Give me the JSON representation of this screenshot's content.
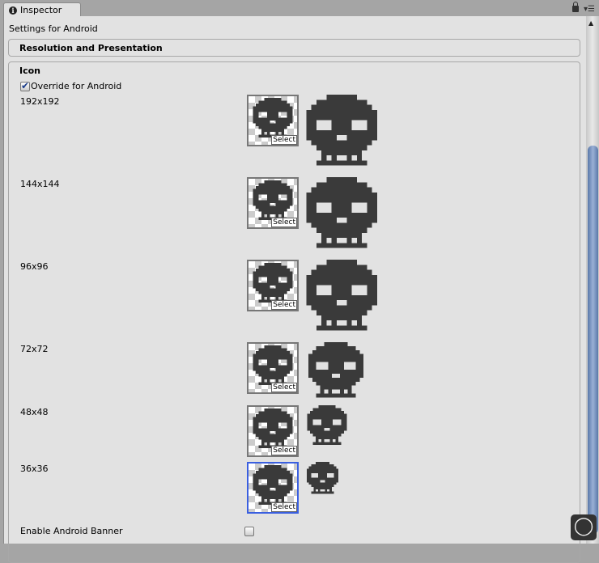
{
  "tab": {
    "title": "Inspector",
    "icon": "info-icon"
  },
  "header": {
    "settings": "Settings for Android",
    "section": "Resolution and Presentation"
  },
  "icon_section": {
    "title": "Icon",
    "override_label": "Override for Android",
    "override_checked": true,
    "rows": [
      {
        "size": "192x192"
      },
      {
        "size": "144x144"
      },
      {
        "size": "96x96"
      },
      {
        "size": "72x72"
      },
      {
        "size": "48x48"
      },
      {
        "size": "36x36",
        "selected": true
      }
    ],
    "select_label": "Select"
  },
  "banner": {
    "label": "Enable Android Banner",
    "checked": false
  },
  "colors": {
    "skull": "#3a3a3a",
    "selection": "#3a5fe0"
  }
}
